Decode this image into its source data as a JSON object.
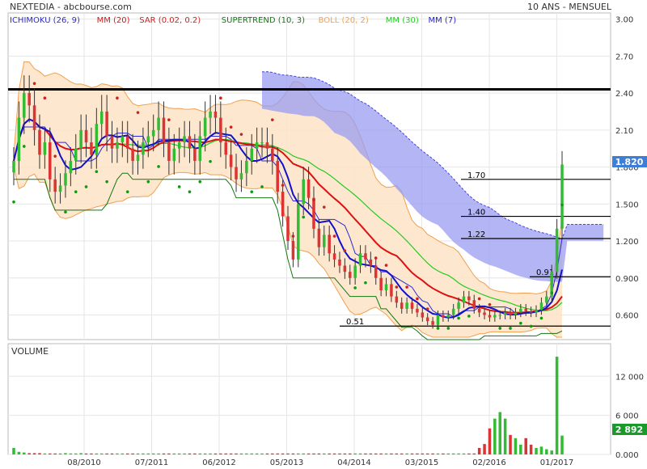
{
  "header": {
    "title": "NEXTEDIA - abcbourse.com",
    "period": "10 ANS - MENSUEL"
  },
  "legend": [
    {
      "label": "ICHIMOKU (26, 9)",
      "color": "#2a2ad6"
    },
    {
      "label": "MM (20)",
      "color": "#dd1111"
    },
    {
      "label": "SAR (0.02, 0.2)",
      "color": "#cc2222"
    },
    {
      "label": "SUPERTREND (10, 3)",
      "color": "#117711"
    },
    {
      "label": "BOLL (20, 2)",
      "color": "#f0a050"
    },
    {
      "label": "MM (30)",
      "color": "#22cc22"
    },
    {
      "label": "MM (7)",
      "color": "#2222cc"
    }
  ],
  "colors": {
    "up": "#33bb33",
    "down": "#dd3333",
    "ichimoku_cloud": "#9a9cf0",
    "bollinger_fill": "#fde3c6",
    "bollinger_line": "#f0a050",
    "price_badge": "#3d7fd6",
    "volume_badge": "#1a9a2a",
    "grid": "#e6e6e6"
  },
  "chart_data": {
    "type": "candlestick",
    "title": "NEXTEDIA - abcbourse.com",
    "period": "10 ANS - MENSUEL",
    "price_axis": {
      "ticks": [
        "3.00",
        "2.70",
        "2.40",
        "2.10",
        "1.800",
        "1.500",
        "1.200",
        "0.900",
        "0.600"
      ],
      "range": [
        0.4,
        3.05
      ]
    },
    "volume_axis": {
      "label": "VOLUME",
      "ticks": [
        "12 000",
        "6 000",
        "0.000"
      ],
      "range": [
        0,
        17000
      ]
    },
    "x_ticks": [
      "08/2010",
      "07/2011",
      "06/2012",
      "05/2013",
      "04/2014",
      "03/2015",
      "02/2016",
      "01/2017"
    ],
    "last_price": "1.820",
    "last_volume": "2 892",
    "horizontal_levels": [
      {
        "value": 2.43,
        "label": ""
      },
      {
        "value": 1.7,
        "label": "1.70"
      },
      {
        "value": 1.4,
        "label": "1.40"
      },
      {
        "value": 1.22,
        "label": "1.22"
      },
      {
        "value": 0.91,
        "label": "0.91"
      },
      {
        "value": 0.51,
        "label": "0.51"
      }
    ],
    "closes": [
      1.85,
      2.2,
      2.4,
      2.3,
      2.1,
      1.9,
      2.0,
      1.7,
      1.6,
      1.65,
      1.75,
      1.85,
      1.95,
      2.1,
      2.0,
      1.9,
      2.15,
      2.25,
      2.05,
      1.95,
      2.0,
      2.05,
      1.95,
      1.85,
      1.9,
      2.0,
      2.05,
      2.1,
      2.2,
      2.0,
      1.85,
      1.95,
      2.0,
      2.05,
      1.95,
      1.85,
      2.05,
      2.2,
      2.25,
      2.2,
      2.0,
      1.9,
      1.8,
      1.7,
      1.75,
      1.85,
      1.95,
      2.0,
      2.0,
      1.95,
      1.85,
      1.6,
      1.4,
      1.2,
      1.05,
      1.5,
      1.7,
      1.55,
      1.3,
      1.15,
      1.25,
      1.1,
      1.05,
      1.0,
      0.95,
      0.9,
      1.0,
      1.1,
      1.05,
      1.0,
      0.9,
      0.8,
      0.85,
      0.75,
      0.7,
      0.65,
      0.7,
      0.65,
      0.62,
      0.58,
      0.55,
      0.52,
      0.6,
      0.58,
      0.6,
      0.65,
      0.7,
      0.75,
      0.72,
      0.65,
      0.62,
      0.6,
      0.58,
      0.6,
      0.6,
      0.62,
      0.6,
      0.62,
      0.65,
      0.63,
      0.62,
      0.64,
      0.7,
      0.75,
      0.95,
      1.3,
      1.82
    ],
    "volumes": [
      1000,
      400,
      300,
      200,
      200,
      200,
      150,
      150,
      150,
      150,
      200,
      150,
      150,
      200,
      150,
      150,
      150,
      150,
      150,
      150,
      150,
      150,
      150,
      150,
      150,
      150,
      150,
      150,
      150,
      150,
      150,
      150,
      150,
      150,
      150,
      150,
      150,
      150,
      150,
      150,
      150,
      150,
      150,
      150,
      150,
      150,
      150,
      150,
      150,
      150,
      150,
      150,
      150,
      150,
      150,
      150,
      150,
      150,
      150,
      150,
      150,
      150,
      150,
      150,
      150,
      150,
      150,
      150,
      150,
      150,
      150,
      150,
      150,
      150,
      150,
      150,
      150,
      150,
      150,
      150,
      150,
      150,
      150,
      150,
      150,
      150,
      150,
      150,
      150,
      150,
      1000,
      1600,
      4000,
      5500,
      6500,
      5500,
      3000,
      2500,
      1500,
      2500,
      1500,
      1000,
      1200,
      800,
      600,
      15000,
      2892
    ]
  }
}
